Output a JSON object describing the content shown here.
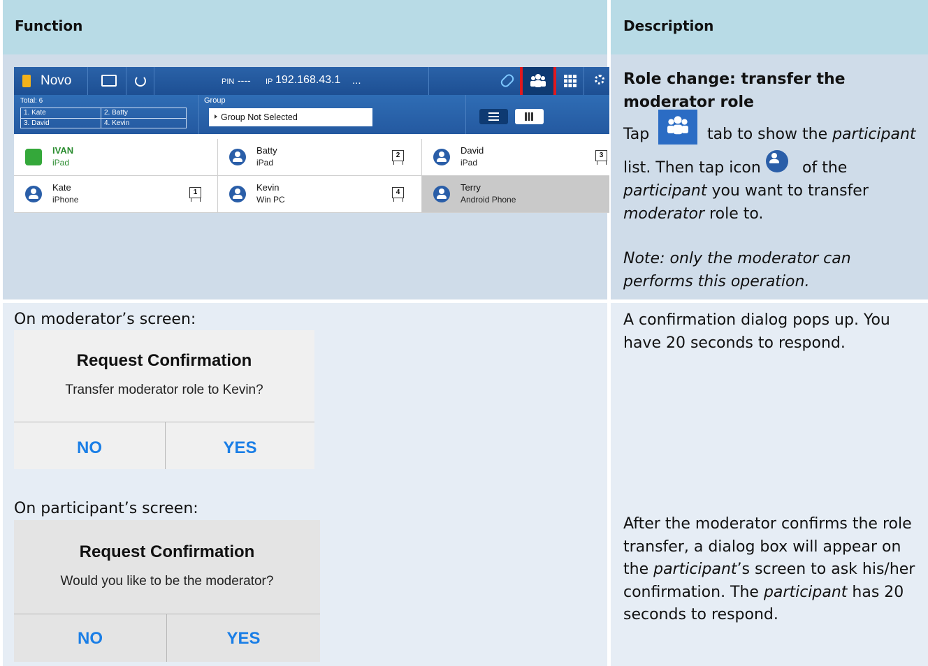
{
  "table": {
    "col_function": "Function",
    "col_description": "Description",
    "row1": {
      "heading": "Role change: transfer the moderator role",
      "tap": "Tap",
      "tab_text_1": "tab to show the ",
      "participant": "participant",
      "list_text": "list. Then tap icon",
      "of_the": "of the",
      "line4_italic": "participant",
      "line4_rest": " you want to transfer",
      "line5_italic": "moderator",
      "line5_rest": " role to.",
      "note": "Note: only the moderator can performs this operation."
    },
    "row2": {
      "moderator_caption": "On moderator’s screen:",
      "participant_caption": "On participant’s screen:",
      "desc1": "A confirmation dialog pops up. You have 20 seconds to respond.",
      "desc2_a": "After the moderator confirms the role transfer, a dialog box will appear on the ",
      "desc2_italic1": "participant",
      "desc2_b": "’s screen to ask his/her confirmation. The ",
      "desc2_italic2": "participant",
      "desc2_c": " has 20 seconds to respond."
    }
  },
  "app": {
    "brand": "Novo",
    "pin_label": "PIN",
    "pin_value": "----",
    "ip_label": "IP",
    "ip_value": "192.168.43.1",
    "ellipsis": "...",
    "total": "Total: 6",
    "mini_list": [
      "1. Kate",
      "2. Batty",
      "3. David",
      "4. Kevin"
    ],
    "group_label": "Group",
    "group_value": "Group Not Selected",
    "participants": [
      {
        "name": "IVAN",
        "device": "iPad",
        "screen": ""
      },
      {
        "name": "Batty",
        "device": "iPad",
        "screen": "2"
      },
      {
        "name": "David",
        "device": "iPad",
        "screen": "3"
      },
      {
        "name": "Kate",
        "device": "iPhone",
        "screen": "1"
      },
      {
        "name": "Kevin",
        "device": "Win PC",
        "screen": "4"
      },
      {
        "name": "Terry",
        "device": "Android Phone",
        "screen": ""
      }
    ],
    "icons": [
      "link-icon",
      "participants-icon",
      "grid-icon",
      "settings-icon",
      "refresh-icon",
      "display-icon",
      "list-view-icon",
      "grid-view-icon"
    ],
    "highlight_color": "#e0191e"
  },
  "dialog_moderator": {
    "title": "Request Confirmation",
    "message": "Transfer moderator role to Kevin?",
    "no": "NO",
    "yes": "YES"
  },
  "dialog_participant": {
    "title": "Request Confirmation",
    "message": "Would you like to be the moderator?",
    "no": "NO",
    "yes": "YES"
  }
}
